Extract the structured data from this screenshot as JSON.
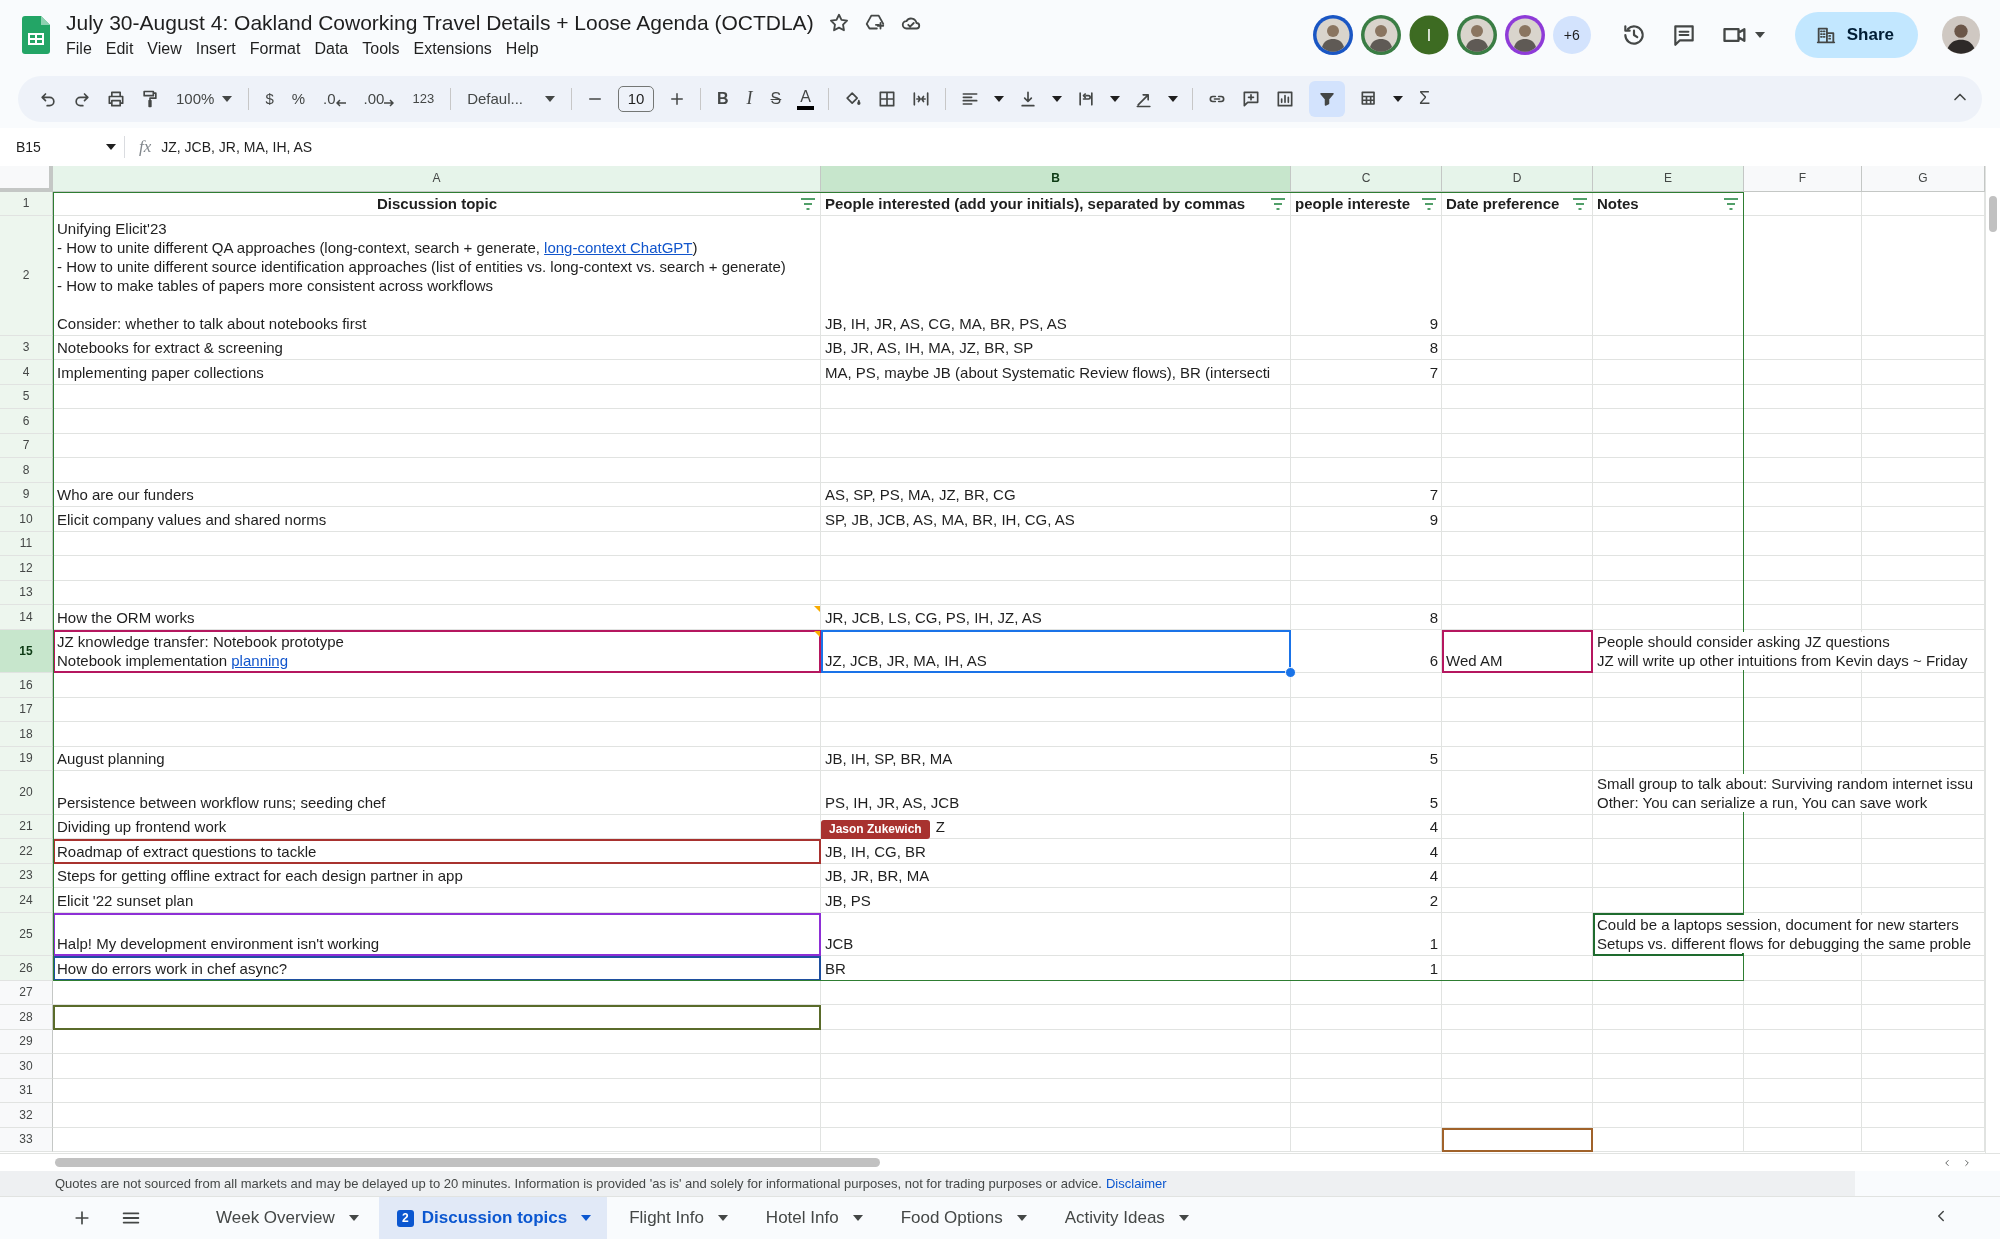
{
  "document": {
    "title": "July 30-August 4: Oakland Coworking Travel Details + Loose Agenda (OCTDLA)",
    "menu": [
      "File",
      "Edit",
      "View",
      "Insert",
      "Format",
      "Data",
      "Tools",
      "Extensions",
      "Help"
    ]
  },
  "collaborators": {
    "avatars": [
      {
        "kind": "photo",
        "color": "#1a56c4"
      },
      {
        "kind": "photo",
        "color": "#3a7d44"
      },
      {
        "kind": "initial",
        "initial": "I",
        "color": "#3d6b22"
      },
      {
        "kind": "photo",
        "color": "#3a7d44"
      },
      {
        "kind": "photo",
        "color": "#8e3bd8"
      }
    ],
    "more": "+6"
  },
  "share_button": "Share",
  "toolbar": {
    "zoom": "100%",
    "currency": "$",
    "percent": "%",
    "decrease_decimals": ".0",
    "increase_decimals": ".00",
    "number_format": "123",
    "font": "Defaul...",
    "font_size": "10",
    "bold": "B",
    "italic": "I",
    "strikethrough": "S",
    "text_color": "A",
    "functions": "Σ",
    "filter_on": true
  },
  "formula_bar": {
    "name_box": "B15",
    "fx": "fx",
    "formula": "JZ, JCB, JR, MA, IH, AS"
  },
  "sheet": {
    "columns": [
      {
        "label": "A",
        "selected": false,
        "in_filter": true
      },
      {
        "label": "B",
        "selected": true,
        "in_filter": true
      },
      {
        "label": "C",
        "selected": false,
        "in_filter": true
      },
      {
        "label": "D",
        "selected": false,
        "in_filter": true
      },
      {
        "label": "E",
        "selected": false,
        "in_filter": true
      },
      {
        "label": "F",
        "selected": false,
        "in_filter": false
      },
      {
        "label": "G",
        "selected": false,
        "in_filter": false
      }
    ],
    "rows": [
      {
        "number": "1",
        "selected": false,
        "in_filter": true,
        "kind": "header",
        "cells": [
          {
            "kind": "text",
            "text": "Discussion topic",
            "centered": true,
            "filter": true
          },
          {
            "kind": "text",
            "text": "People interested (add your initials), separated by commas",
            "filter": true
          },
          {
            "kind": "text",
            "text": "people intereste",
            "filter": true
          },
          {
            "kind": "text",
            "text": "Date preference",
            "filter": true
          },
          {
            "kind": "text",
            "text": "Notes",
            "filter": true
          }
        ]
      },
      {
        "number": "2",
        "selected": false,
        "in_filter": true,
        "cells": [
          {
            "kind": "text",
            "lines": [
              {
                "text": "Unifying Elicit'23"
              },
              {
                "parts": [
                  {
                    "kind": "plain",
                    "text": "- How to unite different QA approaches (long-context, search + generate, "
                  },
                  {
                    "kind": "link",
                    "text": "long-context ChatGPT"
                  },
                  {
                    "kind": "plain",
                    "text": ")"
                  }
                ]
              },
              {
                "text": "- How to unite different source identification approaches (list of entities vs. long-context vs. search + generate)"
              },
              {
                "text": "- How to make tables of papers more consistent across workflows"
              },
              {
                "text": "Consider: whether to talk about notebooks first",
                "gap_before": true
              }
            ]
          },
          {
            "kind": "text",
            "text": "JB, IH, JR, AS, CG, MA, BR, PS, AS"
          },
          {
            "kind": "number",
            "text": "9"
          }
        ]
      },
      {
        "number": "3",
        "selected": false,
        "in_filter": true,
        "cells": [
          {
            "kind": "text",
            "text": "Notebooks for extract & screening"
          },
          {
            "kind": "text",
            "text": "JB, JR, AS, IH, MA, JZ, BR, SP"
          },
          {
            "kind": "number",
            "text": "8"
          }
        ]
      },
      {
        "number": "4",
        "selected": false,
        "in_filter": true,
        "cells": [
          {
            "kind": "text",
            "text": "Implementing paper collections"
          },
          {
            "kind": "text",
            "text": "MA, PS, maybe JB (about Systematic Review flows), BR (intersecti"
          },
          {
            "kind": "number",
            "text": "7"
          }
        ]
      },
      {
        "number": "5",
        "selected": false,
        "in_filter": true
      },
      {
        "number": "6",
        "selected": false,
        "in_filter": true
      },
      {
        "number": "7",
        "selected": false,
        "in_filter": true
      },
      {
        "number": "8",
        "selected": false,
        "in_filter": true
      },
      {
        "number": "9",
        "selected": false,
        "in_filter": true,
        "cells": [
          {
            "kind": "text",
            "text": "Who are our funders"
          },
          {
            "kind": "text",
            "text": "AS, SP, PS, MA, JZ, BR, CG"
          },
          {
            "kind": "number",
            "text": "7"
          }
        ]
      },
      {
        "number": "10",
        "selected": false,
        "in_filter": true,
        "cells": [
          {
            "kind": "text",
            "text": "Elicit company values and shared norms"
          },
          {
            "kind": "text",
            "text": "SP, JB, JCB, AS, MA, BR, IH, CG, AS"
          },
          {
            "kind": "number",
            "text": "9"
          }
        ]
      },
      {
        "number": "11",
        "selected": false,
        "in_filter": true
      },
      {
        "number": "12",
        "selected": false,
        "in_filter": true
      },
      {
        "number": "13",
        "selected": false,
        "in_filter": true
      },
      {
        "number": "14",
        "selected": false,
        "in_filter": true,
        "cells": [
          {
            "kind": "text",
            "text": "How the ORM works",
            "has_comment": true
          },
          {
            "kind": "text",
            "text": "JR, JCB, LS, CG, PS, IH, JZ, AS"
          },
          {
            "kind": "number",
            "text": "8"
          }
        ]
      },
      {
        "number": "15",
        "selected": true,
        "in_filter": true,
        "cells": [
          {
            "kind": "text",
            "color": "#b5175f",
            "has_comment": true,
            "lines": [
              {
                "text": "JZ knowledge transfer: Notebook prototype"
              },
              {
                "parts": [
                  {
                    "kind": "plain",
                    "text": "Notebook implementation "
                  },
                  {
                    "kind": "link",
                    "text": "planning"
                  }
                ]
              }
            ]
          },
          {
            "kind": "text",
            "text": "JZ, JCB, JR, MA, IH, AS"
          },
          {
            "kind": "number",
            "text": "6"
          },
          {
            "kind": "text",
            "text": "Wed AM",
            "color": "#b5175f"
          },
          {
            "kind": "text",
            "lines": [
              {
                "text": "People should consider asking JZ questions"
              },
              {
                "text": "JZ will write up other intuitions from Kevin days ~ Friday"
              }
            ]
          }
        ]
      },
      {
        "number": "16",
        "selected": false,
        "in_filter": true
      },
      {
        "number": "17",
        "selected": false,
        "in_filter": true
      },
      {
        "number": "18",
        "selected": false,
        "in_filter": true
      },
      {
        "number": "19",
        "selected": false,
        "in_filter": true,
        "cells": [
          {
            "kind": "text",
            "text": "August planning"
          },
          {
            "kind": "text",
            "text": "JB, IH, SP, BR, MA"
          },
          {
            "kind": "number",
            "text": "5"
          }
        ]
      },
      {
        "number": "20",
        "selected": false,
        "in_filter": true,
        "cells": [
          {
            "kind": "text",
            "text": "Persistence between workflow runs; seeding chef"
          },
          {
            "kind": "text",
            "text": "PS, IH, JR, AS, JCB"
          },
          {
            "kind": "number",
            "text": "5"
          },
          {
            "kind": "empty"
          },
          {
            "kind": "text",
            "lines": [
              {
                "text": "Small group to talk about: Surviving random internet issu"
              },
              {
                "text": "Other: You can serialize a run, You can save work"
              }
            ]
          }
        ]
      },
      {
        "number": "21",
        "selected": false,
        "in_filter": true,
        "cells": [
          {
            "kind": "text",
            "text": "Dividing up frontend work"
          },
          {
            "kind": "text",
            "text": "Z",
            "cursor": {
              "name": "Jason Zukewich",
              "color": "#a8322f"
            }
          },
          {
            "kind": "number",
            "text": "4"
          }
        ]
      },
      {
        "number": "22",
        "selected": false,
        "in_filter": true,
        "cells": [
          {
            "kind": "text",
            "text": "Roadmap of extract questions to tackle",
            "color": "#a8322f"
          },
          {
            "kind": "text",
            "text": "JB, IH, CG, BR"
          },
          {
            "kind": "number",
            "text": "4"
          }
        ]
      },
      {
        "number": "23",
        "selected": false,
        "in_filter": true,
        "cells": [
          {
            "kind": "text",
            "text": "Steps for getting offline extract for each design partner in app"
          },
          {
            "kind": "text",
            "text": "JB, JR, BR, MA"
          },
          {
            "kind": "number",
            "text": "4"
          }
        ]
      },
      {
        "number": "24",
        "selected": false,
        "in_filter": true,
        "cells": [
          {
            "kind": "text",
            "text": "Elicit '22 sunset plan"
          },
          {
            "kind": "text",
            "text": "JB, PS"
          },
          {
            "kind": "number",
            "text": "2"
          }
        ]
      },
      {
        "number": "25",
        "selected": false,
        "in_filter": true,
        "cells": [
          {
            "kind": "text",
            "text": "Halp! My development environment isn't working",
            "color": "#8e2fd6"
          },
          {
            "kind": "text",
            "text": "JCB"
          },
          {
            "kind": "number",
            "text": "1"
          },
          {
            "kind": "empty"
          },
          {
            "kind": "text",
            "color": "#1e6b2e",
            "lines": [
              {
                "text": "Could be a laptops session, document for new starters"
              },
              {
                "text": "Setups vs. different flows for debugging the same proble"
              }
            ]
          }
        ]
      },
      {
        "number": "26",
        "selected": false,
        "in_filter": true,
        "cells": [
          {
            "kind": "text",
            "text": "How do errors work in chef async?",
            "color": "#1f4fa0"
          },
          {
            "kind": "text",
            "text": "BR"
          },
          {
            "kind": "number",
            "text": "1"
          }
        ]
      },
      {
        "number": "27",
        "selected": false,
        "in_filter": false
      },
      {
        "number": "28",
        "selected": false,
        "in_filter": false,
        "cells": [
          {
            "kind": "empty",
            "color": "#5a6b2a"
          }
        ]
      },
      {
        "number": "29",
        "selected": false,
        "in_filter": false
      },
      {
        "number": "30",
        "selected": false,
        "in_filter": false
      },
      {
        "number": "31",
        "selected": false,
        "in_filter": false
      },
      {
        "number": "32",
        "selected": false,
        "in_filter": false
      },
      {
        "number": "33",
        "selected": false,
        "in_filter": false,
        "cells": [
          {
            "kind": "empty"
          },
          {
            "kind": "empty"
          },
          {
            "kind": "empty"
          },
          {
            "kind": "empty",
            "color": "#a0622a"
          }
        ]
      }
    ]
  },
  "notice": {
    "text": "Quotes are not sourced from all markets and may be delayed up to 20 minutes. Information is provided 'as is' and solely for informational purposes, not for trading purposes or advice.",
    "link": "Disclaimer"
  },
  "sheet_tabs": [
    {
      "label": "Week Overview",
      "selected": false
    },
    {
      "label": "Discussion topics",
      "selected": true,
      "badge": "2"
    },
    {
      "label": "Flight Info",
      "selected": false
    },
    {
      "label": "Hotel Info",
      "selected": false
    },
    {
      "label": "Food Options",
      "selected": false
    },
    {
      "label": "Activity Ideas",
      "selected": false
    }
  ]
}
